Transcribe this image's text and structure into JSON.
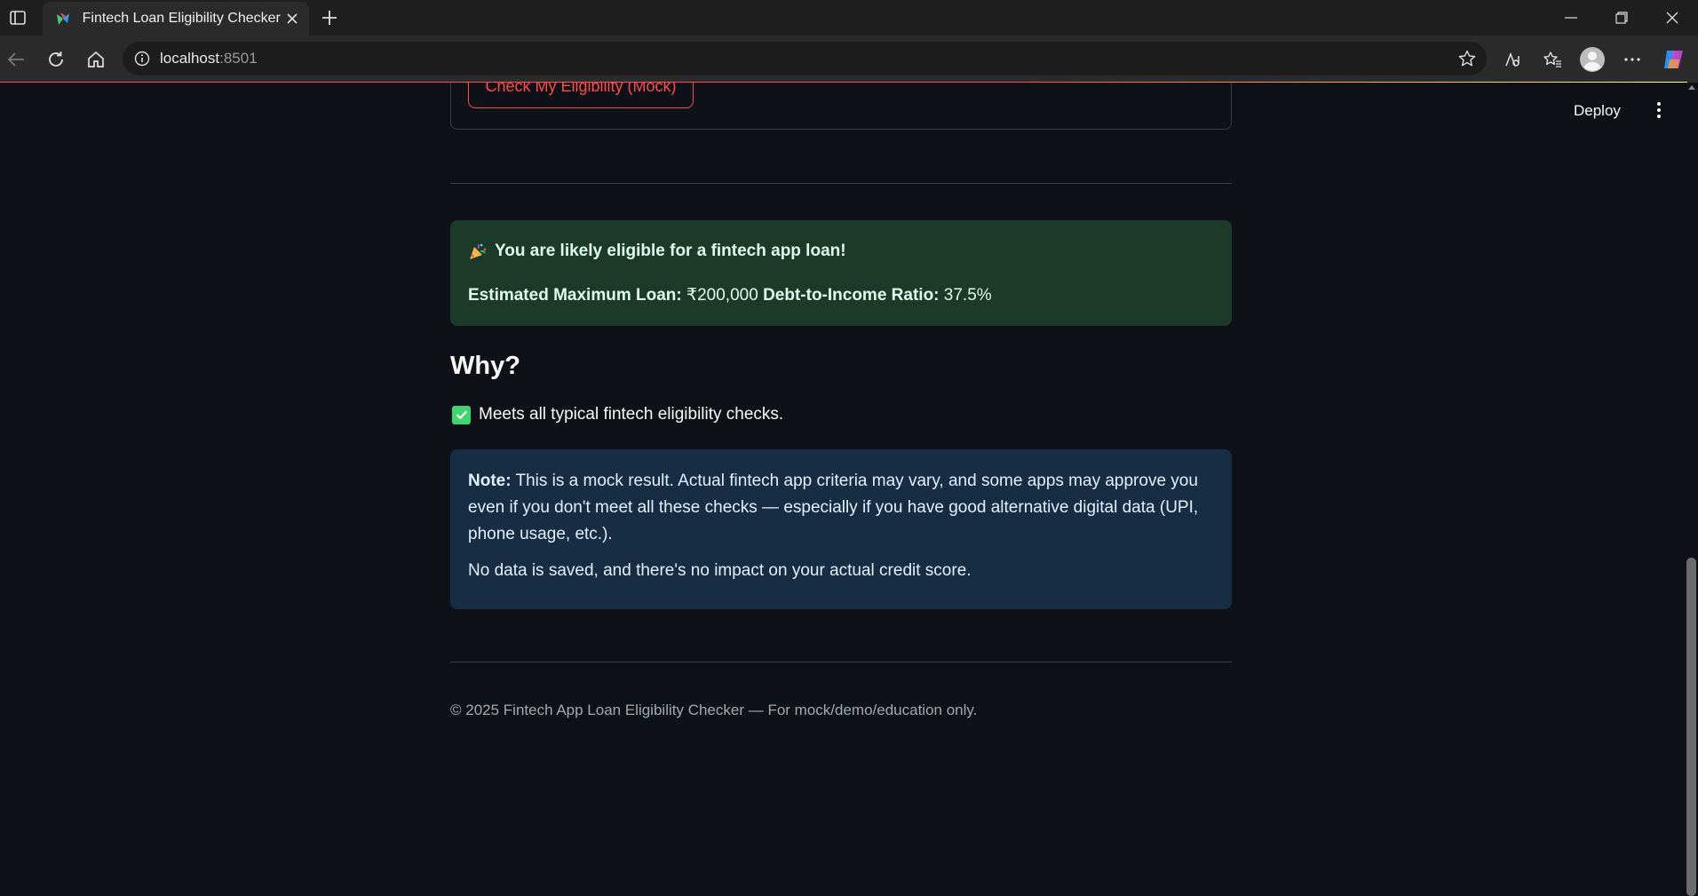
{
  "browser": {
    "tab_title": "Fintech Loan Eligibility Checker",
    "address_host": "localhost",
    "address_port": ":8501"
  },
  "app": {
    "deploy_label": "Deploy",
    "form": {
      "submit_label": "Check My Eligibility (Mock)"
    },
    "result": {
      "headline": "You are likely eligible for a fintech app loan!",
      "max_loan_label": "Estimated Maximum Loan:",
      "max_loan_value": "₹200,000",
      "dti_label": "Debt-to-Income Ratio:",
      "dti_value": "37.5%"
    },
    "why": {
      "heading": "Why?",
      "reason": "Meets all typical fintech eligibility checks."
    },
    "note": {
      "label": "Note:",
      "text": "This is a mock result. Actual fintech app criteria may vary, and some apps may approve you even if you don't meet all these checks — especially if you have good alternative digital data (UPI, phone usage, etc.).",
      "privacy": "No data is saved, and there's no impact on your actual credit score."
    },
    "footer": "© 2025 Fintech App Loan Eligibility Checker — For mock/demo/education only."
  },
  "colors": {
    "background": "#0e1117",
    "primary": "#ff4b4b",
    "success_bg": "#1b3a2a",
    "info_bg": "#172d43"
  },
  "icons": [
    "sidebar-toggle-icon",
    "favicon-icon",
    "close-icon",
    "plus-icon",
    "minimize-icon",
    "restore-icon",
    "back-icon",
    "reload-icon",
    "home-icon",
    "info-icon",
    "star-icon",
    "read-aloud-icon",
    "favorites-icon",
    "profile-icon",
    "more-icon",
    "copilot-icon",
    "party-popper-icon",
    "check-mark-icon",
    "kebab-menu-icon"
  ]
}
